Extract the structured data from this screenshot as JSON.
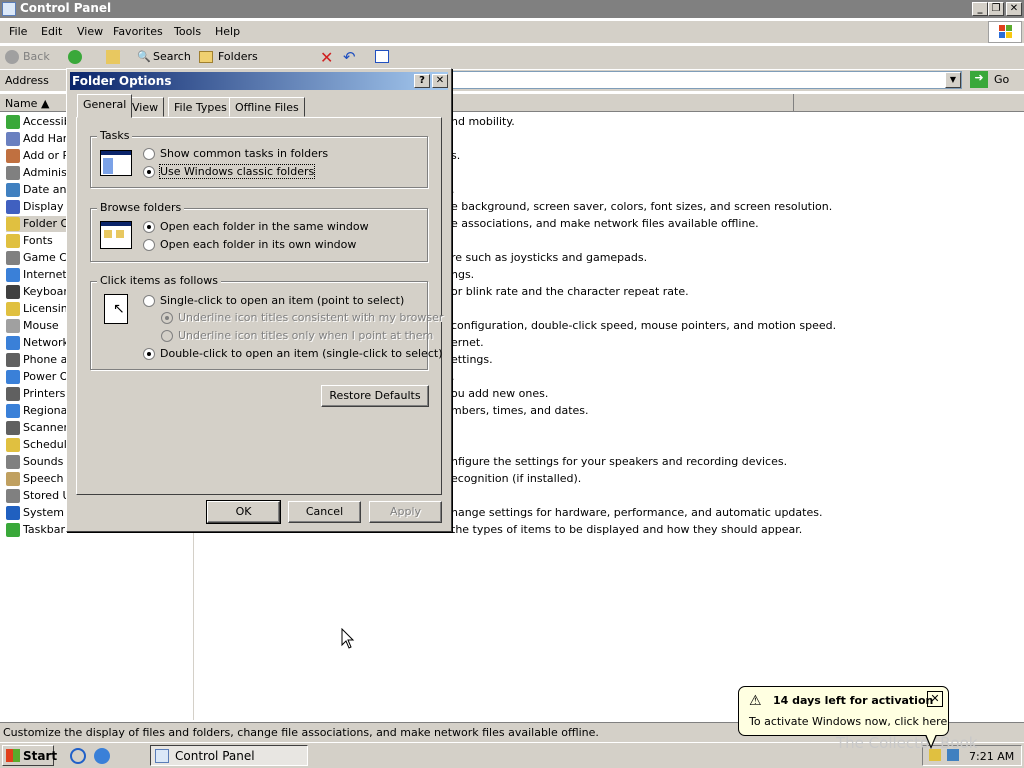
{
  "window": {
    "title": "Control Panel"
  },
  "menu": [
    "File",
    "Edit",
    "View",
    "Favorites",
    "Tools",
    "Help"
  ],
  "toolbar": {
    "back": "Back",
    "search": "Search",
    "folders": "Folders"
  },
  "address": {
    "label": "Address",
    "go": "Go"
  },
  "list": {
    "col_name": "Name"
  },
  "items": [
    "Accessibility Options",
    "Add Hardware",
    "Add or Remove Programs",
    "Administrative Tools",
    "Date and Time",
    "Display",
    "Folder Options",
    "Fonts",
    "Game Controllers",
    "Internet Options",
    "Keyboard",
    "Licensing",
    "Mouse",
    "Network Connections",
    "Phone and Modem Options",
    "Power Options",
    "Printers and Faxes",
    "Regional and Language Options",
    "Scanners and Cameras",
    "Scheduled Tasks",
    "Sounds and Audio Devices",
    "Speech",
    "Stored User Names and Passwords",
    "System",
    "Taskbar and Start Menu"
  ],
  "comments": [
    {
      "row": 0,
      "text": "nd mobility."
    },
    {
      "row": 2,
      "text": "s."
    },
    {
      "row": 4,
      "text": "."
    },
    {
      "row": 5,
      "text": "e background, screen saver, colors, font sizes, and screen resolution."
    },
    {
      "row": 6,
      "text": "e associations, and make network files available offline."
    },
    {
      "row": 8,
      "text": "re such as joysticks and gamepads."
    },
    {
      "row": 9,
      "text": "ngs."
    },
    {
      "row": 10,
      "text": "or blink rate and the character repeat rate."
    },
    {
      "row": 12,
      "text": "configuration, double-click speed, mouse pointers, and motion speed."
    },
    {
      "row": 13,
      "text": "ernet."
    },
    {
      "row": 14,
      "text": "ettings."
    },
    {
      "row": 15,
      "text": "."
    },
    {
      "row": 16,
      "text": "ou add new ones."
    },
    {
      "row": 17,
      "text": "mbers, times, and dates."
    },
    {
      "row": 20,
      "text": "nfigure the settings for your speakers and recording devices."
    },
    {
      "row": 21,
      "text": "ecognition (if installed)."
    },
    {
      "row": 23,
      "text": "hange settings for hardware, performance, and automatic updates."
    },
    {
      "row": 24,
      "text": "the types of items to be displayed and how they should appear."
    }
  ],
  "status": "Customize the display of files and folders, change file associations, and make network files available offline.",
  "dialog": {
    "title": "Folder Options",
    "tabs": [
      "General",
      "View",
      "File Types",
      "Offline Files"
    ],
    "tasks": {
      "label": "Tasks",
      "opt1": "Show common tasks in folders",
      "opt2": "Use Windows classic folders"
    },
    "browse": {
      "label": "Browse folders",
      "opt1": "Open each folder in the same window",
      "opt2": "Open each folder in its own window"
    },
    "click": {
      "label": "Click items as follows",
      "opt1": "Single-click to open an item (point to select)",
      "sub1": "Underline icon titles consistent with my browser",
      "sub2": "Underline icon titles only when I point at them",
      "opt2": "Double-click to open an item (single-click to select)"
    },
    "restore": "Restore Defaults",
    "ok": "OK",
    "cancel": "Cancel",
    "apply": "Apply"
  },
  "balloon": {
    "title": "14 days left for activation",
    "text": "To activate Windows now, click here"
  },
  "taskbar": {
    "start": "Start",
    "task": "Control Panel",
    "clock": "7:21 AM"
  },
  "watermark": "The Collector Book"
}
